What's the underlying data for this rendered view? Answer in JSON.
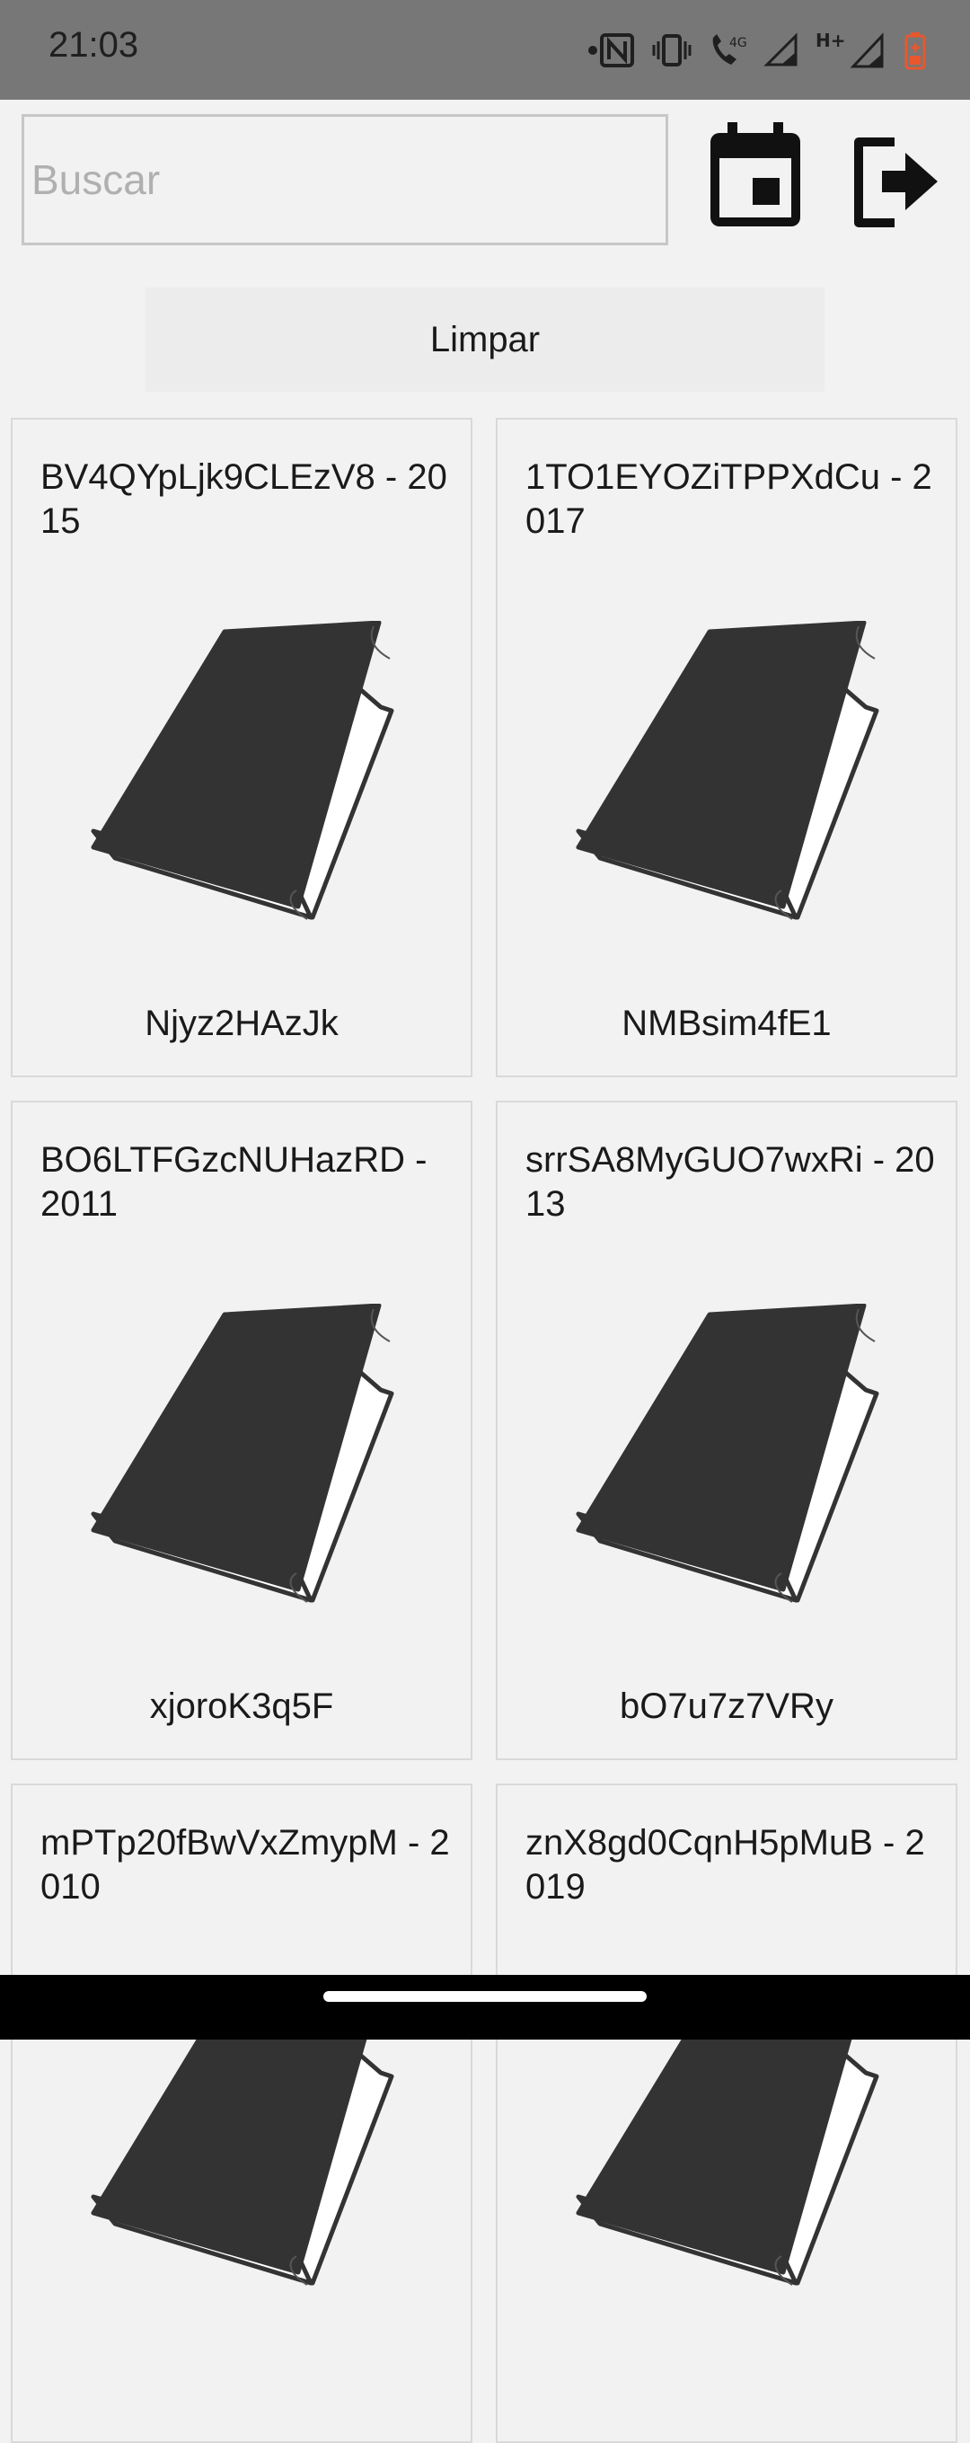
{
  "status_bar": {
    "time": "21:03",
    "icons": [
      "nfc-icon",
      "vibrate-icon",
      "wifi-calling-icon",
      "signal-icon",
      "signal-h-plus-icon",
      "battery-icon"
    ],
    "network_label_4g": "4G",
    "network_label_h": "H+"
  },
  "search": {
    "placeholder": "Buscar",
    "value": ""
  },
  "toolbar": {
    "calendar_icon": "calendar-icon",
    "logout_icon": "logout-icon",
    "clear_label": "Limpar"
  },
  "books": [
    {
      "title": "BV4QYpLjk9CLEzV8 - 2015",
      "subtitle": "Njyz2HAzJk"
    },
    {
      "title": "1TO1EYOZiTPPXdCu - 2017",
      "subtitle": "NMBsim4fE1"
    },
    {
      "title": "BO6LTFGzcNUHazRD - 2011",
      "subtitle": "xjoroK3q5F"
    },
    {
      "title": "srrSA8MyGUO7wxRi - 2013",
      "subtitle": "bO7u7z7VRy"
    },
    {
      "title": "mPTp20fBwVxZmypM - 2010",
      "subtitle": ""
    },
    {
      "title": "znX8gd0CqnH5pMuB - 2019",
      "subtitle": ""
    }
  ],
  "colors": {
    "status_bar": "#777777",
    "background": "#f2f2f2",
    "battery": "#e8572d",
    "book_cover": "#333333"
  }
}
